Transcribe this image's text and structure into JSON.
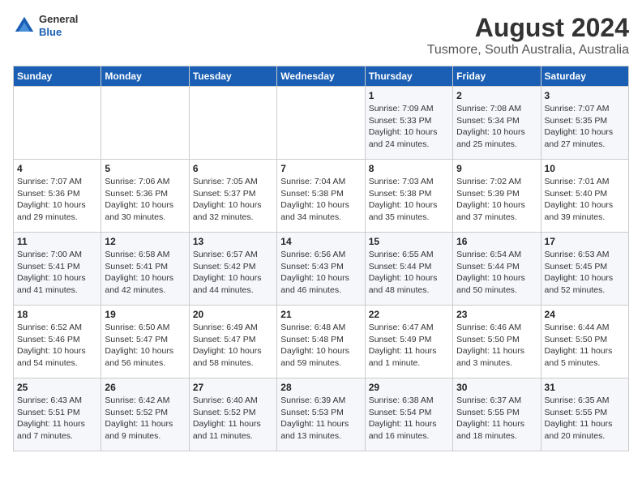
{
  "header": {
    "logo": {
      "general": "General",
      "blue": "Blue"
    },
    "title": "August 2024",
    "subtitle": "Tusmore, South Australia, Australia"
  },
  "days_of_week": [
    "Sunday",
    "Monday",
    "Tuesday",
    "Wednesday",
    "Thursday",
    "Friday",
    "Saturday"
  ],
  "weeks": [
    [
      {
        "day": "",
        "info": ""
      },
      {
        "day": "",
        "info": ""
      },
      {
        "day": "",
        "info": ""
      },
      {
        "day": "",
        "info": ""
      },
      {
        "day": "1",
        "sunrise": "7:09 AM",
        "sunset": "5:33 PM",
        "daylight": "10 hours and 24 minutes."
      },
      {
        "day": "2",
        "sunrise": "7:08 AM",
        "sunset": "5:34 PM",
        "daylight": "10 hours and 25 minutes."
      },
      {
        "day": "3",
        "sunrise": "7:07 AM",
        "sunset": "5:35 PM",
        "daylight": "10 hours and 27 minutes."
      }
    ],
    [
      {
        "day": "4",
        "sunrise": "7:07 AM",
        "sunset": "5:36 PM",
        "daylight": "10 hours and 29 minutes."
      },
      {
        "day": "5",
        "sunrise": "7:06 AM",
        "sunset": "5:36 PM",
        "daylight": "10 hours and 30 minutes."
      },
      {
        "day": "6",
        "sunrise": "7:05 AM",
        "sunset": "5:37 PM",
        "daylight": "10 hours and 32 minutes."
      },
      {
        "day": "7",
        "sunrise": "7:04 AM",
        "sunset": "5:38 PM",
        "daylight": "10 hours and 34 minutes."
      },
      {
        "day": "8",
        "sunrise": "7:03 AM",
        "sunset": "5:38 PM",
        "daylight": "10 hours and 35 minutes."
      },
      {
        "day": "9",
        "sunrise": "7:02 AM",
        "sunset": "5:39 PM",
        "daylight": "10 hours and 37 minutes."
      },
      {
        "day": "10",
        "sunrise": "7:01 AM",
        "sunset": "5:40 PM",
        "daylight": "10 hours and 39 minutes."
      }
    ],
    [
      {
        "day": "11",
        "sunrise": "7:00 AM",
        "sunset": "5:41 PM",
        "daylight": "10 hours and 41 minutes."
      },
      {
        "day": "12",
        "sunrise": "6:58 AM",
        "sunset": "5:41 PM",
        "daylight": "10 hours and 42 minutes."
      },
      {
        "day": "13",
        "sunrise": "6:57 AM",
        "sunset": "5:42 PM",
        "daylight": "10 hours and 44 minutes."
      },
      {
        "day": "14",
        "sunrise": "6:56 AM",
        "sunset": "5:43 PM",
        "daylight": "10 hours and 46 minutes."
      },
      {
        "day": "15",
        "sunrise": "6:55 AM",
        "sunset": "5:44 PM",
        "daylight": "10 hours and 48 minutes."
      },
      {
        "day": "16",
        "sunrise": "6:54 AM",
        "sunset": "5:44 PM",
        "daylight": "10 hours and 50 minutes."
      },
      {
        "day": "17",
        "sunrise": "6:53 AM",
        "sunset": "5:45 PM",
        "daylight": "10 hours and 52 minutes."
      }
    ],
    [
      {
        "day": "18",
        "sunrise": "6:52 AM",
        "sunset": "5:46 PM",
        "daylight": "10 hours and 54 minutes."
      },
      {
        "day": "19",
        "sunrise": "6:50 AM",
        "sunset": "5:47 PM",
        "daylight": "10 hours and 56 minutes."
      },
      {
        "day": "20",
        "sunrise": "6:49 AM",
        "sunset": "5:47 PM",
        "daylight": "10 hours and 58 minutes."
      },
      {
        "day": "21",
        "sunrise": "6:48 AM",
        "sunset": "5:48 PM",
        "daylight": "10 hours and 59 minutes."
      },
      {
        "day": "22",
        "sunrise": "6:47 AM",
        "sunset": "5:49 PM",
        "daylight": "11 hours and 1 minute."
      },
      {
        "day": "23",
        "sunrise": "6:46 AM",
        "sunset": "5:50 PM",
        "daylight": "11 hours and 3 minutes."
      },
      {
        "day": "24",
        "sunrise": "6:44 AM",
        "sunset": "5:50 PM",
        "daylight": "11 hours and 5 minutes."
      }
    ],
    [
      {
        "day": "25",
        "sunrise": "6:43 AM",
        "sunset": "5:51 PM",
        "daylight": "11 hours and 7 minutes."
      },
      {
        "day": "26",
        "sunrise": "6:42 AM",
        "sunset": "5:52 PM",
        "daylight": "11 hours and 9 minutes."
      },
      {
        "day": "27",
        "sunrise": "6:40 AM",
        "sunset": "5:52 PM",
        "daylight": "11 hours and 11 minutes."
      },
      {
        "day": "28",
        "sunrise": "6:39 AM",
        "sunset": "5:53 PM",
        "daylight": "11 hours and 13 minutes."
      },
      {
        "day": "29",
        "sunrise": "6:38 AM",
        "sunset": "5:54 PM",
        "daylight": "11 hours and 16 minutes."
      },
      {
        "day": "30",
        "sunrise": "6:37 AM",
        "sunset": "5:55 PM",
        "daylight": "11 hours and 18 minutes."
      },
      {
        "day": "31",
        "sunrise": "6:35 AM",
        "sunset": "5:55 PM",
        "daylight": "11 hours and 20 minutes."
      }
    ]
  ]
}
